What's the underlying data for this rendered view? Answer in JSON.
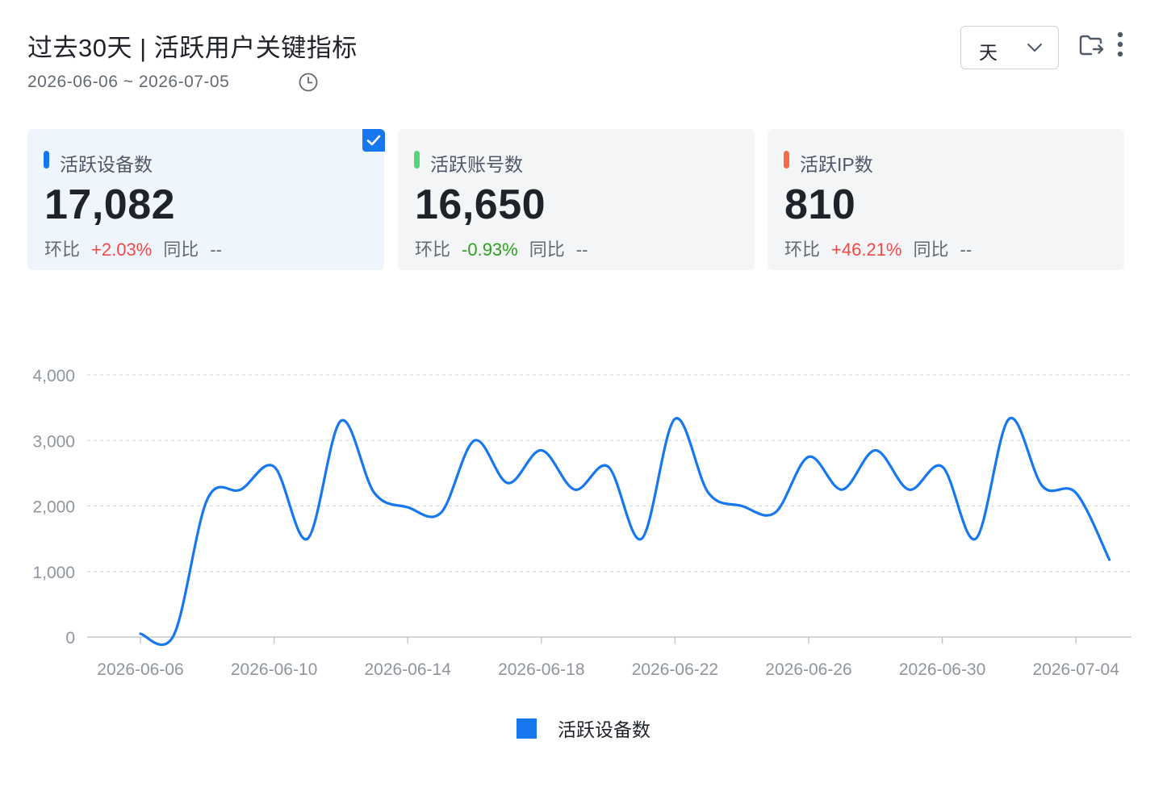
{
  "header": {
    "title": "过去30天 | 活跃用户关键指标",
    "date_range": "2026-06-06 ~ 2026-07-05",
    "period_select": {
      "value": "天"
    },
    "icons": {
      "clock": "clock-icon",
      "export": "folder-export-icon",
      "more": "more-vertical-icon"
    }
  },
  "metrics": [
    {
      "name": "活跃设备数",
      "value": "17,082",
      "mom_label": "环比",
      "mom": "+2.03%",
      "mom_dir": "up",
      "yoy_label": "同比",
      "yoy": "--",
      "color": "#1677ef",
      "selected": true
    },
    {
      "name": "活跃账号数",
      "value": "16,650",
      "mom_label": "环比",
      "mom": "-0.93%",
      "mom_dir": "down",
      "yoy_label": "同比",
      "yoy": "--",
      "color": "#5ad27a",
      "selected": false
    },
    {
      "name": "活跃IP数",
      "value": "810",
      "mom_label": "环比",
      "mom": "+46.21%",
      "mom_dir": "up",
      "yoy_label": "同比",
      "yoy": "--",
      "color": "#f26b45",
      "selected": false
    }
  ],
  "chart_data": {
    "type": "line",
    "x": [
      "2026-06-06",
      "2026-06-07",
      "2026-06-08",
      "2026-06-09",
      "2026-06-10",
      "2026-06-11",
      "2026-06-12",
      "2026-06-13",
      "2026-06-14",
      "2026-06-15",
      "2026-06-16",
      "2026-06-17",
      "2026-06-18",
      "2026-06-19",
      "2026-06-20",
      "2026-06-21",
      "2026-06-22",
      "2026-06-23",
      "2026-06-24",
      "2026-06-25",
      "2026-06-26",
      "2026-06-27",
      "2026-06-28",
      "2026-06-29",
      "2026-06-30",
      "2026-07-01",
      "2026-07-02",
      "2026-07-03",
      "2026-07-04",
      "2026-07-05"
    ],
    "x_ticks": [
      "2026-06-06",
      "2026-06-10",
      "2026-06-14",
      "2026-06-18",
      "2026-06-22",
      "2026-06-26",
      "2026-06-30",
      "2026-07-04"
    ],
    "series": [
      {
        "name": "活跃设备数",
        "color": "#1677ef",
        "values": [
          50,
          30,
          2100,
          2250,
          2600,
          1500,
          3300,
          2200,
          1980,
          1900,
          3000,
          2350,
          2850,
          2250,
          2600,
          1500,
          3330,
          2200,
          2000,
          1900,
          2750,
          2250,
          2850,
          2250,
          2600,
          1500,
          3330,
          2300,
          2200,
          1180
        ]
      }
    ],
    "ylim": [
      0,
      4000
    ],
    "y_ticks": [
      0,
      1000,
      2000,
      3000,
      4000
    ],
    "y_tick_labels": [
      "0",
      "1,000",
      "2,000",
      "3,000",
      "4,000"
    ],
    "grid": true,
    "legend": "bottom-center",
    "xlabel": "",
    "ylabel": ""
  }
}
